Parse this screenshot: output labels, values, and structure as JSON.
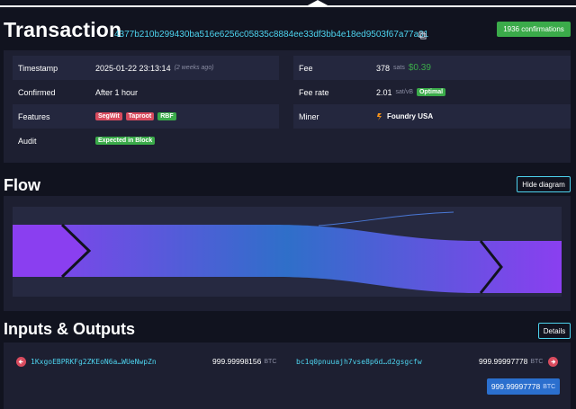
{
  "page": {
    "title": "Transaction",
    "txid": "4377b210b299430ba516e6256c05835c8884ee33df3bb4e18ed9503f67a77a31",
    "confirmations": "1936 confirmations"
  },
  "details": {
    "timestamp_label": "Timestamp",
    "timestamp_value": "2025-01-22 23:13:14",
    "timestamp_ago": "(2 weeks ago)",
    "confirmed_label": "Confirmed",
    "confirmed_value": "After 1 hour",
    "features_label": "Features",
    "features": [
      "SegWit",
      "Taproot",
      "RBF"
    ],
    "audit_label": "Audit",
    "audit_value": "Expected in Block",
    "fee_label": "Fee",
    "fee_value": "378",
    "fee_unit": "sats",
    "fee_usd": "$0.39",
    "feerate_label": "Fee rate",
    "feerate_value": "2.01",
    "feerate_unit": "sat/vB",
    "feerate_badge": "Optimal",
    "miner_label": "Miner",
    "miner_value": "Foundry USA"
  },
  "flow": {
    "title": "Flow",
    "hide_button": "Hide diagram"
  },
  "io": {
    "title": "Inputs & Outputs",
    "details_button": "Details",
    "input_address": "1KxgoEBPRKFg2ZKEoN6a…WUeNwpZn",
    "input_amount": "999.99998156",
    "output_address": "bc1q0pnuuajh7vse8p6d…d2gsgcfw",
    "output_amount": "999.99997778",
    "unit": "BTC",
    "total_amount": "999.99997778",
    "total_unit": "BTC"
  },
  "colors": {
    "background": "#11131f",
    "panel": "#1d1f31",
    "accent": "#4dd3ee",
    "success": "#3bab4a",
    "danger": "#d84b5e",
    "primary": "#2b6fce"
  }
}
